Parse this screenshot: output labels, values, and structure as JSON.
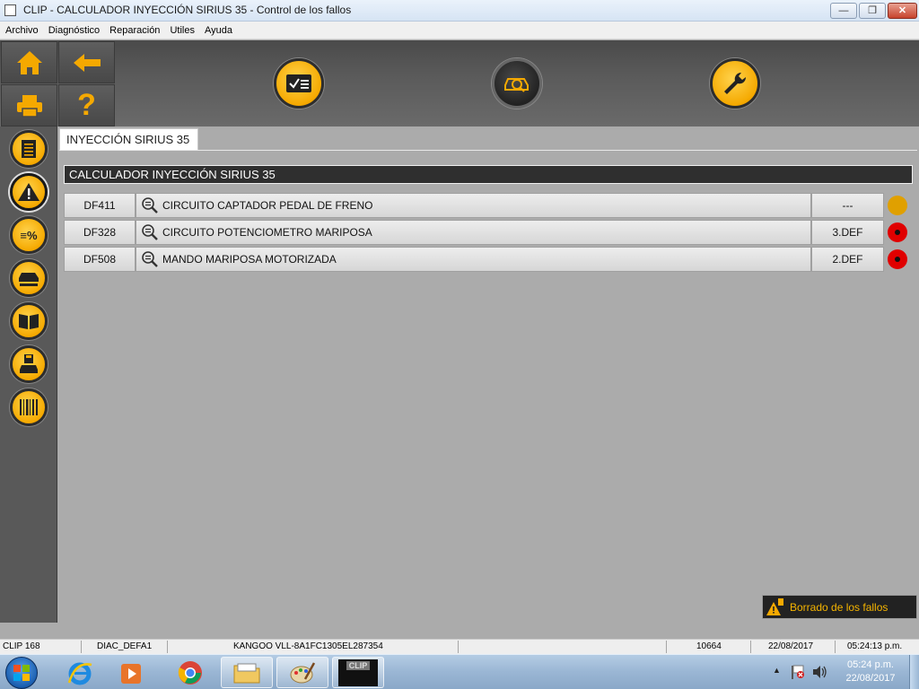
{
  "window": {
    "title": "CLIP - CALCULADOR INYECCIÓN SIRIUS 35 - Control de los fallos",
    "minimize": "—",
    "maximize": "❐",
    "close": "✕"
  },
  "menu": [
    "Archivo",
    "Diagnóstico",
    "Reparación",
    "Utiles",
    "Ayuda"
  ],
  "toolbar": {
    "help_label": "?",
    "icons": [
      "home-icon",
      "back-arrow-icon",
      "print-icon",
      "help-icon",
      "checklist-icon",
      "vehicle-scan-icon",
      "wrench-icon"
    ]
  },
  "sidebar": {
    "icons": [
      "document-icon",
      "warning-icon",
      "percent-values-icon",
      "vehicle-config-icon",
      "manual-book-icon",
      "save-vehicle-icon",
      "barcode-icon"
    ],
    "percent_glyph": "≡%"
  },
  "tab": {
    "label": "INYECCIÓN SIRIUS 35"
  },
  "ecu_title": "CALCULADOR INYECCIÓN SIRIUS 35",
  "faults": [
    {
      "code": "DF411",
      "description": "CIRCUITO CAPTADOR PEDAL DE FRENO",
      "status": "---",
      "indicator": "amber"
    },
    {
      "code": "DF328",
      "description": "CIRCUITO POTENCIOMETRO MARIPOSA",
      "status": "3.DEF",
      "indicator": "red"
    },
    {
      "code": "DF508",
      "description": "MANDO MARIPOSA MOTORIZADA",
      "status": "2.DEF",
      "indicator": "red"
    }
  ],
  "clear_faults_label": "Borrado de los fallos",
  "statusbar": {
    "clip_version": "CLIP 168",
    "diag_mode": "DIAC_DEFA1",
    "vehicle": "KANGOO VLL-8A1FC1305EL287354",
    "counter": "10664",
    "date": "22/08/2017",
    "time": "05:24:13 p.m."
  },
  "taskbar": {
    "clock_time": "05:24 p.m.",
    "clock_date": "22/08/2017",
    "clip_app_label": "CLIP",
    "tray_arrow": "▲"
  },
  "colors": {
    "accent_yellow": "#f5a900",
    "status_amber": "#e0a000",
    "status_red": "#e00000"
  }
}
